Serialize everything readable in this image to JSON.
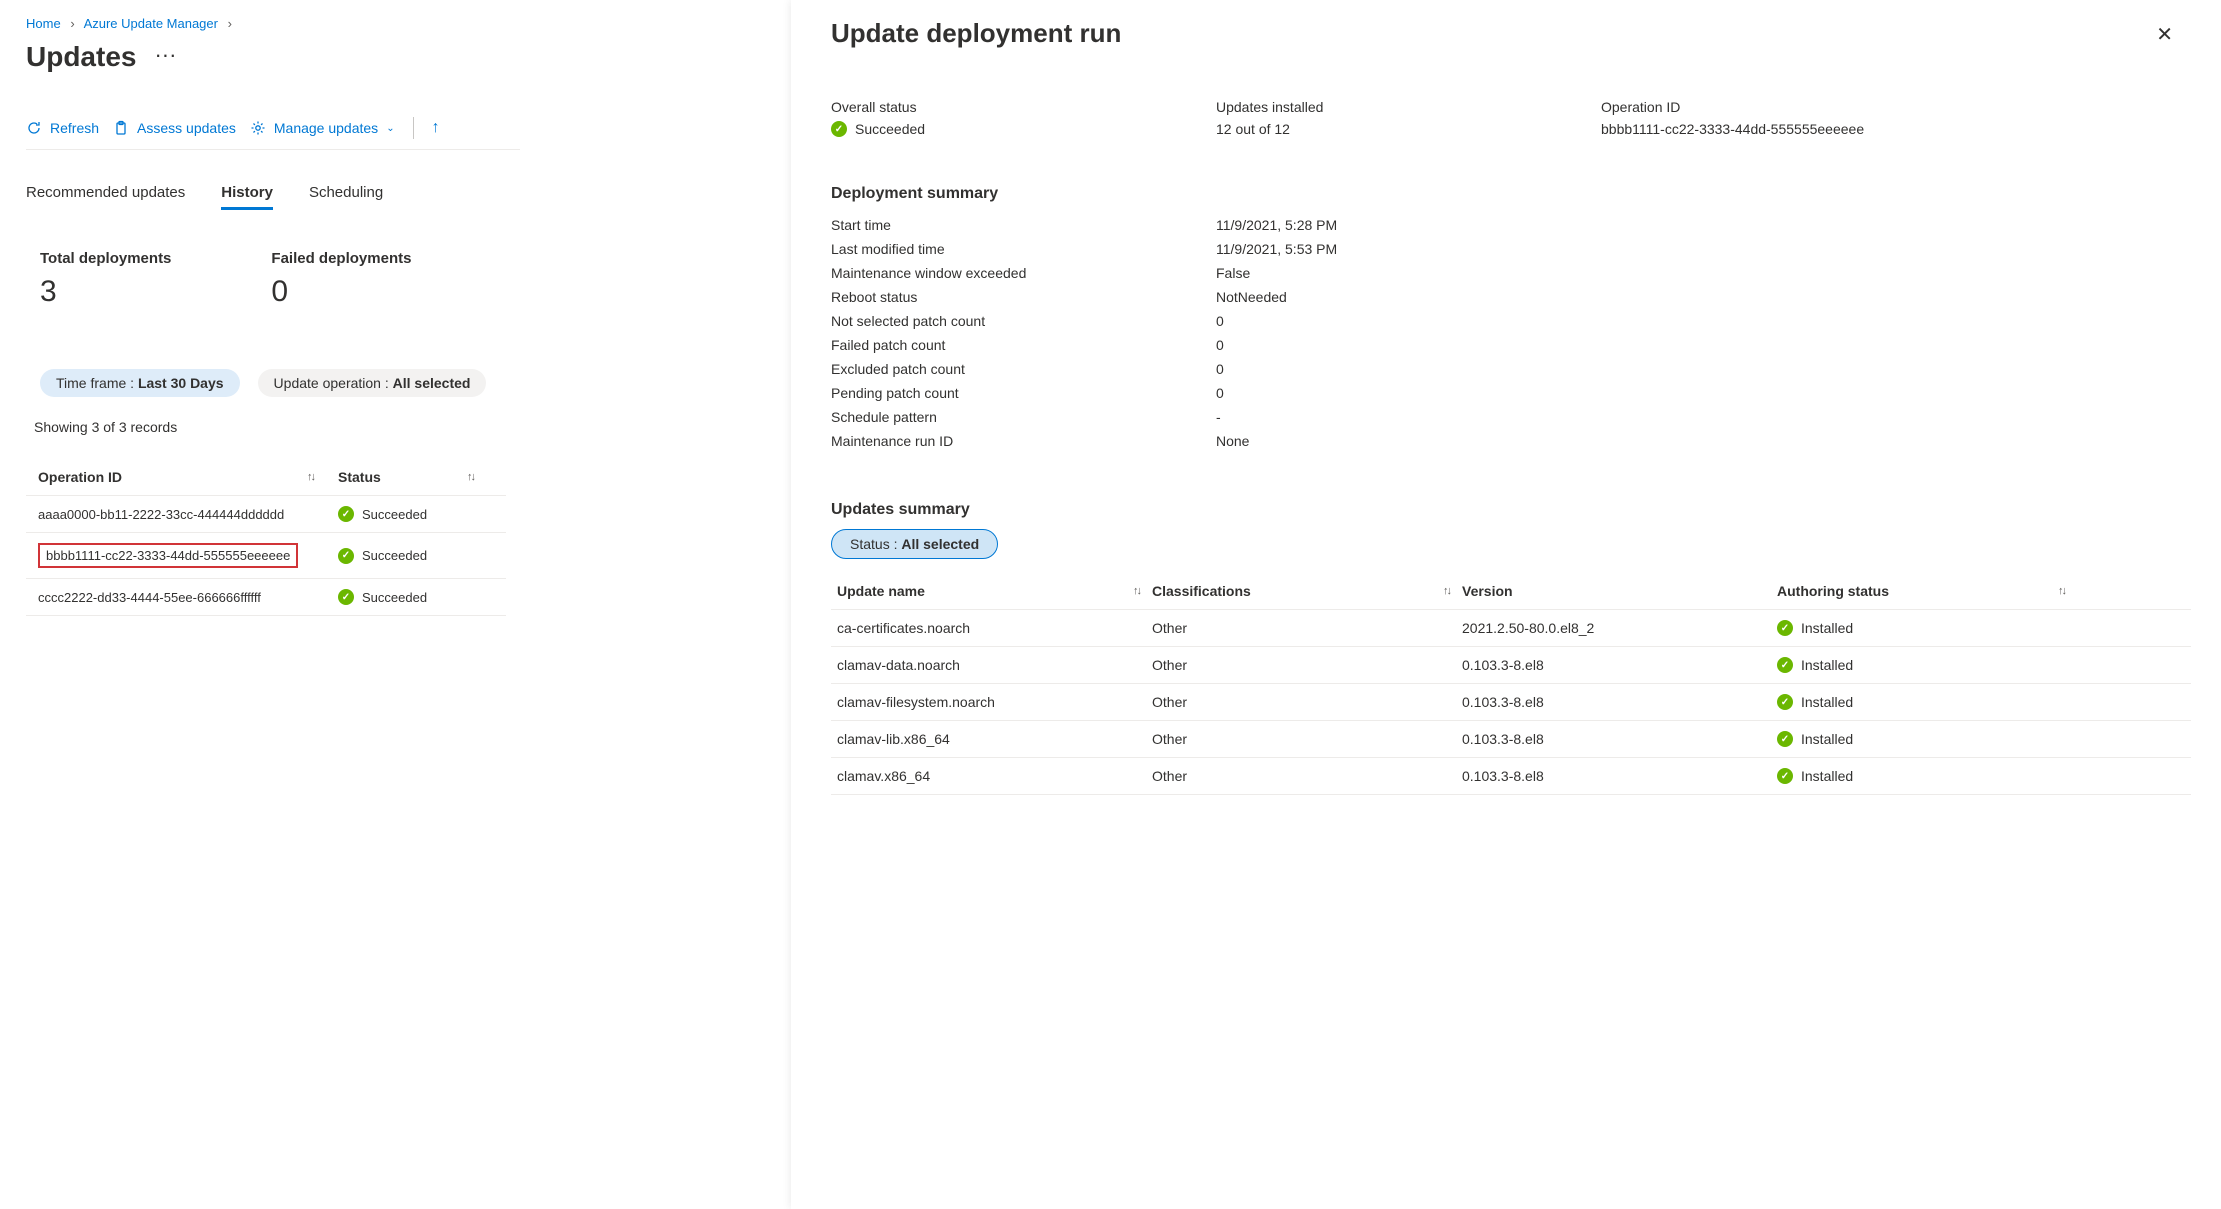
{
  "breadcrumb": {
    "home": "Home",
    "parent": "Azure Update Manager"
  },
  "page_title": "Updates",
  "toolbar": {
    "refresh": "Refresh",
    "assess": "Assess updates",
    "manage": "Manage updates"
  },
  "tabs": {
    "recommended": "Recommended updates",
    "history": "History",
    "scheduling": "Scheduling"
  },
  "stats": {
    "total_label": "Total deployments",
    "total_value": "3",
    "failed_label": "Failed deployments",
    "failed_value": "0"
  },
  "filters": {
    "time_label": "Time frame : ",
    "time_value": "Last 30 Days",
    "op_label": "Update operation : ",
    "op_value": "All selected"
  },
  "records_text": "Showing 3 of 3 records",
  "table_headers": {
    "op": "Operation ID",
    "status": "Status"
  },
  "table_rows": [
    {
      "id": "aaaa0000-bb11-2222-33cc-444444dddddd",
      "status": "Succeeded",
      "highlight": false
    },
    {
      "id": "bbbb1111-cc22-3333-44dd-555555eeeeee",
      "status": "Succeeded",
      "highlight": true
    },
    {
      "id": "cccc2222-dd33-4444-55ee-666666ffffff",
      "status": "Succeeded",
      "highlight": false
    }
  ],
  "panel": {
    "title": "Update deployment run",
    "overview": {
      "overall_label": "Overall status",
      "overall_value": "Succeeded",
      "installed_label": "Updates installed",
      "installed_value": "12 out of 12",
      "opid_label": "Operation ID",
      "opid_value": "bbbb1111-cc22-3333-44dd-555555eeeeee"
    },
    "summary_h": "Deployment summary",
    "summary": [
      {
        "lbl": "Start time",
        "val": "11/9/2021, 5:28 PM"
      },
      {
        "lbl": "Last modified time",
        "val": "11/9/2021, 5:53 PM"
      },
      {
        "lbl": "Maintenance window exceeded",
        "val": "False"
      },
      {
        "lbl": "Reboot status",
        "val": "NotNeeded"
      },
      {
        "lbl": "Not selected patch count",
        "val": "0"
      },
      {
        "lbl": "Failed patch count",
        "val": "0"
      },
      {
        "lbl": "Excluded patch count",
        "val": "0"
      },
      {
        "lbl": "Pending patch count",
        "val": "0"
      },
      {
        "lbl": "Schedule pattern",
        "val": "-"
      },
      {
        "lbl": "Maintenance run ID",
        "val": "None"
      }
    ],
    "updates_h": "Updates summary",
    "status_pill_label": "Status : ",
    "status_pill_value": "All selected",
    "updates_headers": {
      "name": "Update name",
      "class": "Classifications",
      "ver": "Version",
      "auth": "Authoring status"
    },
    "updates_rows": [
      {
        "name": "ca-certificates.noarch",
        "class": "Other",
        "ver": "2021.2.50-80.0.el8_2",
        "auth": "Installed"
      },
      {
        "name": "clamav-data.noarch",
        "class": "Other",
        "ver": "0.103.3-8.el8",
        "auth": "Installed"
      },
      {
        "name": "clamav-filesystem.noarch",
        "class": "Other",
        "ver": "0.103.3-8.el8",
        "auth": "Installed"
      },
      {
        "name": "clamav-lib.x86_64",
        "class": "Other",
        "ver": "0.103.3-8.el8",
        "auth": "Installed"
      },
      {
        "name": "clamav.x86_64",
        "class": "Other",
        "ver": "0.103.3-8.el8",
        "auth": "Installed"
      }
    ]
  }
}
